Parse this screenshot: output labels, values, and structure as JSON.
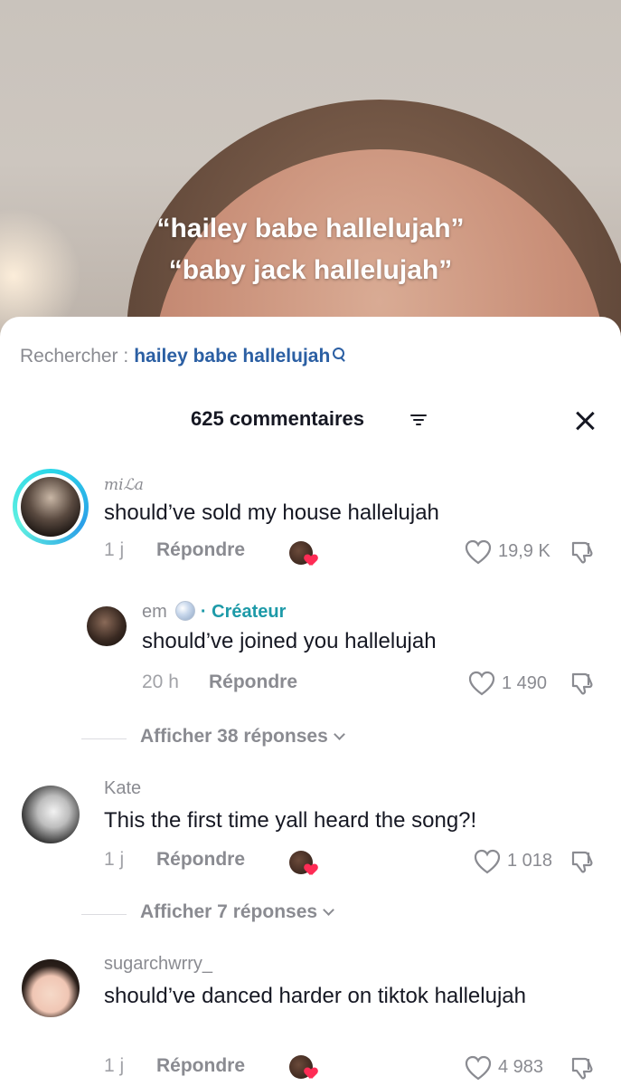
{
  "video": {
    "caption_line1": "“hailey babe hallelujah”",
    "caption_line2": "“baby jack hallelujah”"
  },
  "search": {
    "label": "Rechercher :",
    "term": "hailey babe hallelujah",
    "icon": "search-icon"
  },
  "header": {
    "title": "625 commentaires",
    "sort_icon": "sort-icon",
    "close_icon": "close-icon"
  },
  "comments": [
    {
      "username": "miℒa",
      "text": "should’ve sold my house hallelujah",
      "time": "1 j",
      "reply_label": "Répondre",
      "likes": "19,9 K",
      "creator_liked": true
    },
    {
      "username": "em",
      "badge": "· Créateur",
      "text": "should’ve joined you hallelujah",
      "time": "20 h",
      "reply_label": "Répondre",
      "likes": "1 490",
      "is_reply": true
    },
    {
      "username": "Kate",
      "text": "This the first time yall heard the song?!",
      "time": "1 j",
      "reply_label": "Répondre",
      "likes": "1 018",
      "creator_liked": true
    },
    {
      "username": "sugarchwrry_",
      "text": "should’ve danced harder on tiktok hallelujah",
      "time": "1 j",
      "reply_label": "Répondre",
      "likes": "4 983",
      "creator_liked": true
    }
  ],
  "view_replies": [
    {
      "label": "Afficher 38 réponses"
    },
    {
      "label": "Afficher 7 réponses"
    }
  ],
  "colors": {
    "accent_link": "#2b5fa3",
    "creator_badge": "#1d9aa8",
    "heart": "#fe2c55",
    "muted_text": "#8a8b91"
  }
}
